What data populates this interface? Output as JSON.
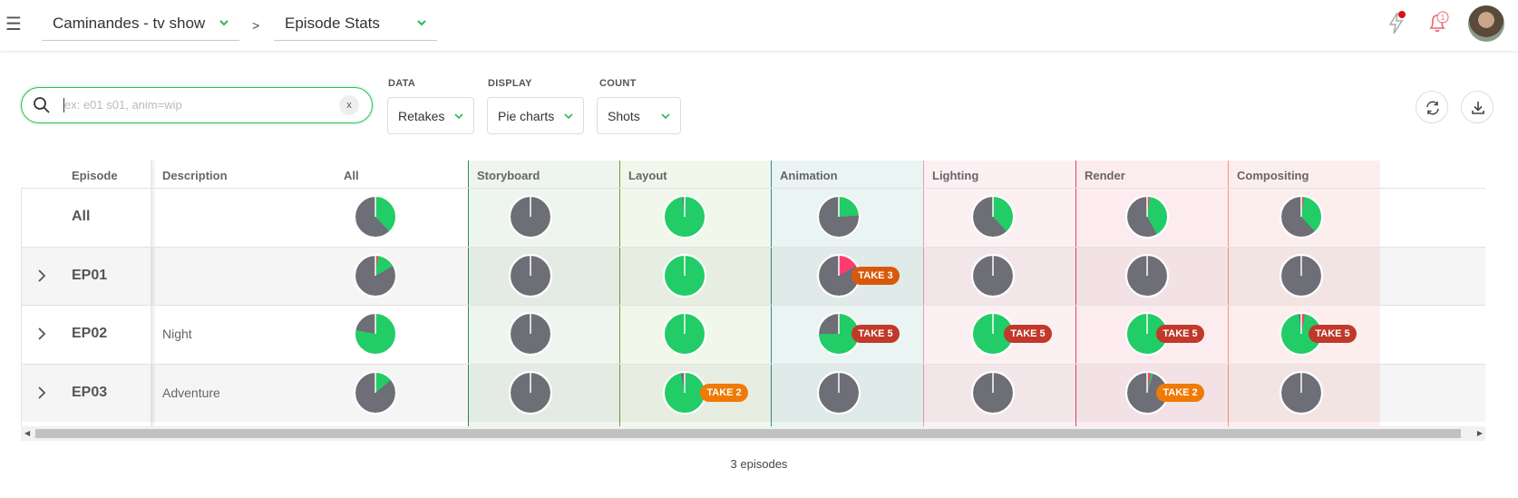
{
  "topbar": {
    "production": "Caminandes - tv show",
    "separator": ">",
    "view": "Episode Stats"
  },
  "search": {
    "placeholder": "ex: e01 s01, anim=wip",
    "clear_label": "x"
  },
  "filters": {
    "data": {
      "label": "DATA",
      "value": "Retakes"
    },
    "display": {
      "label": "DISPLAY",
      "value": "Pie charts"
    },
    "count": {
      "label": "COUNT",
      "value": "Shots"
    }
  },
  "table": {
    "headers": {
      "episode": "Episode",
      "description": "Description",
      "all": "All",
      "tasks": [
        "Storyboard",
        "Layout",
        "Animation",
        "Lighting",
        "Render",
        "Compositing"
      ]
    },
    "task_colors": {
      "Storyboard": "#2e8b57",
      "Layout": "#7a9a3a",
      "Animation": "#2e8b8b",
      "Lighting": "#e7a0ae",
      "Render": "#e0436b",
      "Compositing": "#ff8c80"
    },
    "rows": [
      {
        "name": "All",
        "description": "",
        "expandable": false
      },
      {
        "name": "EP01",
        "description": "",
        "expandable": true
      },
      {
        "name": "EP02",
        "description": "Night",
        "expandable": true
      },
      {
        "name": "EP03",
        "description": "Adventure",
        "expandable": true
      }
    ],
    "pies": [
      [
        [
          0.38,
          0,
          0
        ],
        [
          0,
          0,
          0
        ],
        [
          0.98,
          0,
          0
        ],
        [
          0.24,
          0,
          0
        ],
        [
          0.38,
          0,
          0
        ],
        [
          0.4,
          0.02,
          0
        ],
        [
          0.36,
          0.02,
          0
        ]
      ],
      [
        [
          0.15,
          0.02,
          0
        ],
        [
          0,
          0,
          0
        ],
        [
          1,
          0,
          0
        ],
        [
          0,
          0.17,
          0
        ],
        [
          0,
          0,
          0
        ],
        [
          0,
          0,
          0
        ],
        [
          0,
          0,
          0
        ]
      ],
      [
        [
          0.78,
          0,
          0
        ],
        [
          0,
          0,
          0
        ],
        [
          1,
          0,
          0
        ],
        [
          0.75,
          0,
          0
        ],
        [
          1,
          0,
          0
        ],
        [
          1,
          0,
          0
        ],
        [
          0.95,
          0.03,
          0
        ]
      ],
      [
        [
          0.14,
          0,
          0
        ],
        [
          0,
          0,
          0
        ],
        [
          0.96,
          0.01,
          0
        ],
        [
          0,
          0,
          0
        ],
        [
          0,
          0,
          0
        ],
        [
          0.02,
          0.03,
          0
        ],
        [
          0,
          0,
          0
        ]
      ]
    ],
    "badges": [
      {
        "row": 1,
        "task": "Animation",
        "text": "TAKE 3",
        "color": "#d9590b"
      },
      {
        "row": 2,
        "task": "Animation",
        "text": "TAKE 5",
        "color": "#c0392b"
      },
      {
        "row": 2,
        "task": "Lighting",
        "text": "TAKE 5",
        "color": "#c0392b"
      },
      {
        "row": 2,
        "task": "Render",
        "text": "TAKE 5",
        "color": "#c0392b"
      },
      {
        "row": 2,
        "task": "Compositing",
        "text": "TAKE 5",
        "color": "#c0392b"
      },
      {
        "row": 3,
        "task": "Layout",
        "text": "TAKE 2",
        "color": "#ef7a05"
      },
      {
        "row": 3,
        "task": "Render",
        "text": "TAKE 2",
        "color": "#ef7a05"
      }
    ],
    "pie_colors": {
      "done": "#22cc66",
      "retake": "#ff3c6e",
      "other": "#6d6e76"
    }
  },
  "footer": {
    "count_text": "3 episodes"
  }
}
